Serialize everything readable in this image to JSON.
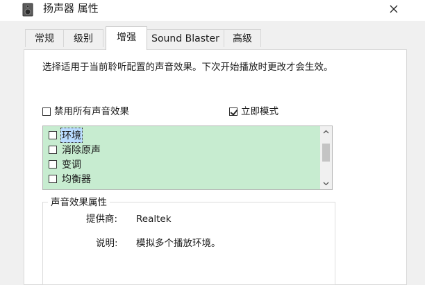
{
  "window": {
    "title": "扬声器 属性",
    "icon": "speaker-icon",
    "close_icon": "close-icon"
  },
  "tabs": [
    {
      "label": "常规",
      "active": false
    },
    {
      "label": "级别",
      "active": false
    },
    {
      "label": "增强",
      "active": true
    },
    {
      "label": "Sound Blaster",
      "active": false
    },
    {
      "label": "高级",
      "active": false
    }
  ],
  "enhancements": {
    "description": "选择适用于当前聆听配置的声音效果。下次开始播放时更改才会生效。",
    "disable_all_label": "禁用所有声音效果",
    "disable_all_checked": false,
    "immediate_mode_label": "立即模式",
    "immediate_mode_checked": true,
    "effects": [
      {
        "label": "环境",
        "checked": false,
        "selected": true
      },
      {
        "label": "消除原声",
        "checked": false,
        "selected": false
      },
      {
        "label": "变调",
        "checked": false,
        "selected": false
      },
      {
        "label": "均衡器",
        "checked": false,
        "selected": false
      }
    ],
    "properties": {
      "group_title": "声音效果属性",
      "provider_label": "提供商:",
      "provider_value": "Realtek",
      "description_label": "说明:",
      "description_value": "模拟多个播放环境。"
    }
  },
  "colors": {
    "list_background": "#c7ecd0",
    "selection": "#b9dcff"
  }
}
